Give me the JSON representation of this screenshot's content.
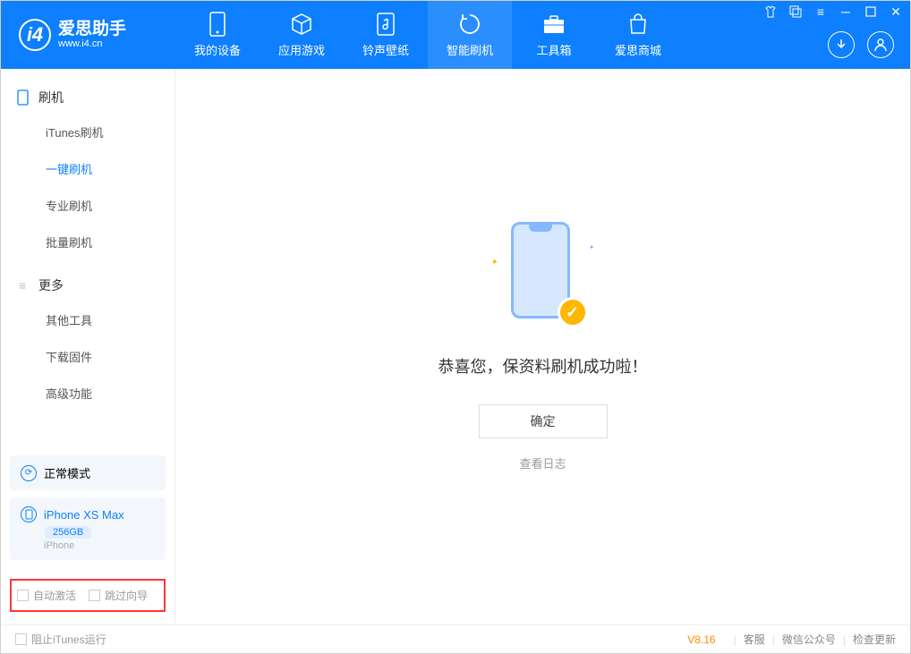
{
  "app": {
    "title": "爱思助手",
    "url": "www.i4.cn"
  },
  "nav": {
    "tabs": [
      {
        "label": "我的设备"
      },
      {
        "label": "应用游戏"
      },
      {
        "label": "铃声壁纸"
      },
      {
        "label": "智能刷机"
      },
      {
        "label": "工具箱"
      },
      {
        "label": "爱思商城"
      }
    ]
  },
  "sidebar": {
    "group1": {
      "title": "刷机"
    },
    "items1": [
      {
        "label": "iTunes刷机"
      },
      {
        "label": "一键刷机"
      },
      {
        "label": "专业刷机"
      },
      {
        "label": "批量刷机"
      }
    ],
    "group2": {
      "title": "更多"
    },
    "items2": [
      {
        "label": "其他工具"
      },
      {
        "label": "下载固件"
      },
      {
        "label": "高级功能"
      }
    ],
    "mode": {
      "label": "正常模式"
    },
    "device": {
      "name": "iPhone XS Max",
      "storage": "256GB",
      "type": "iPhone"
    },
    "checkboxes": {
      "auto_activate": "自动激活",
      "skip_wizard": "跳过向导"
    }
  },
  "main": {
    "success_message": "恭喜您，保资料刷机成功啦！",
    "confirm": "确定",
    "view_log": "查看日志"
  },
  "footer": {
    "block_itunes": "阻止iTunes运行",
    "version": "V8.16",
    "links": {
      "service": "客服",
      "wechat": "微信公众号",
      "update": "检查更新"
    }
  }
}
